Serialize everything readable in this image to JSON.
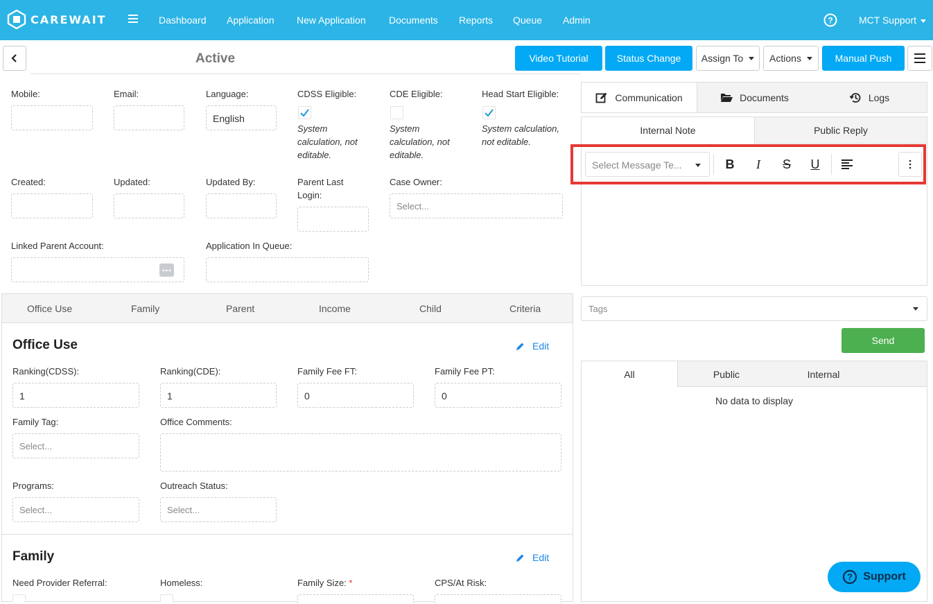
{
  "app": {
    "logo_text": "CAREWAIT"
  },
  "nav": {
    "items": [
      "Dashboard",
      "Application",
      "New Application",
      "Documents",
      "Reports",
      "Queue",
      "Admin"
    ],
    "user": "MCT Support"
  },
  "header": {
    "status": "Active",
    "buttons": {
      "video_tutorial": "Video Tutorial",
      "status_change": "Status Change",
      "assign_to": "Assign To",
      "actions": "Actions",
      "manual_push": "Manual Push"
    }
  },
  "details": {
    "mobile": {
      "label": "Mobile:",
      "value": ""
    },
    "email": {
      "label": "Email:",
      "value": ""
    },
    "language": {
      "label": "Language:",
      "value": "English"
    },
    "cdss": {
      "label": "CDSS Eligible:",
      "checked": true,
      "note": "System calculation, not editable."
    },
    "cde": {
      "label": "CDE Eligible:",
      "checked": false,
      "note": "System calculation, not editable."
    },
    "head_start": {
      "label": "Head Start Eligible:",
      "checked": true,
      "note": "System calculation, not editable."
    },
    "created": {
      "label": "Created:",
      "value": ""
    },
    "updated": {
      "label": "Updated:",
      "value": ""
    },
    "updated_by": {
      "label": "Updated By:",
      "value": ""
    },
    "parent_last_login": {
      "label": "Parent Last Login:",
      "value": ""
    },
    "case_owner": {
      "label": "Case Owner:",
      "placeholder": "Select..."
    },
    "linked_parent": {
      "label": "Linked Parent Account:",
      "value": ""
    },
    "in_queue": {
      "label": "Application In Queue:",
      "value": ""
    }
  },
  "section_tabs": [
    "Office Use",
    "Family",
    "Parent",
    "Income",
    "Child",
    "Criteria"
  ],
  "office_use": {
    "title": "Office Use",
    "edit": "Edit",
    "ranking_cdss": {
      "label": "Ranking(CDSS):",
      "value": "1"
    },
    "ranking_cde": {
      "label": "Ranking(CDE):",
      "value": "1"
    },
    "fee_ft": {
      "label": "Family Fee FT:",
      "value": "0"
    },
    "fee_pt": {
      "label": "Family Fee PT:",
      "value": "0"
    },
    "family_tag": {
      "label": "Family Tag:",
      "placeholder": "Select..."
    },
    "office_comments": {
      "label": "Office Comments:",
      "value": ""
    },
    "programs": {
      "label": "Programs:",
      "placeholder": "Select..."
    },
    "outreach": {
      "label": "Outreach Status:",
      "placeholder": "Select..."
    }
  },
  "family": {
    "title": "Family",
    "edit": "Edit",
    "need_provider": "Need Provider Referral:",
    "homeless": "Homeless:",
    "family_size": "Family Size:",
    "required_mark": "*",
    "cps": "CPS/At Risk:"
  },
  "panel": {
    "tabs": {
      "communication": "Communication",
      "documents": "Documents",
      "logs": "Logs"
    },
    "subtabs": {
      "internal": "Internal Note",
      "public": "Public Reply"
    },
    "template_placeholder": "Select Message Te...",
    "toolbar": {
      "bold": "B",
      "italic": "I",
      "strike": "S",
      "underline": "U"
    },
    "tags_placeholder": "Tags",
    "send": "Send",
    "msg_tabs": [
      "All",
      "Public",
      "Internal"
    ],
    "empty": "No data to display"
  },
  "support": {
    "label": "Support"
  },
  "colors": {
    "primary": "#2bb4e5",
    "button": "#03a9f4",
    "send": "#4caf50",
    "highlight": "#e53935"
  }
}
